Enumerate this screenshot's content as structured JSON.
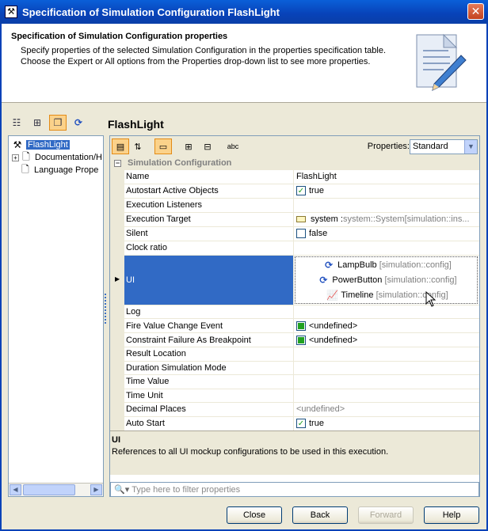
{
  "window": {
    "title": "Specification of Simulation Configuration FlashLight",
    "close_glyph": "✕"
  },
  "header": {
    "heading": "Specification of Simulation Configuration properties",
    "line1": "Specify properties of the selected Simulation Configuration in the properties specification table.",
    "line2": "Choose the Expert or All options from the Properties drop-down list to see more properties."
  },
  "panel": {
    "title": "FlashLight"
  },
  "tree": {
    "items": [
      {
        "label": "FlashLight",
        "icon": "tools-icon",
        "selected": true
      },
      {
        "label": "Documentation/H",
        "icon": "document-icon",
        "expander": "+"
      },
      {
        "label": "Language Prope",
        "icon": "document-icon"
      }
    ]
  },
  "properties": {
    "label": "Properties:",
    "selected": "Standard",
    "group": "Simulation Configuration",
    "rows": [
      {
        "name": "Name",
        "value": "FlashLight"
      },
      {
        "name": "Autostart Active Objects",
        "value": "true",
        "kind": "checked"
      },
      {
        "name": "Execution Listeners",
        "value": ""
      },
      {
        "name": "Execution Target",
        "value": "system : ",
        "value_b": "system::System",
        "value_c": " [simulation::ins..."
      },
      {
        "name": "Silent",
        "value": "false",
        "kind": "unchecked"
      },
      {
        "name": "Clock ratio",
        "value": ""
      },
      {
        "name": "UI",
        "kind": "ui",
        "items": [
          {
            "label": "LampBulb",
            "ref": "[simulation::config]",
            "icon": "refresh-icon"
          },
          {
            "label": "PowerButton",
            "ref": "[simulation::config]",
            "icon": "refresh-icon"
          },
          {
            "label": "Timeline",
            "ref": "[simulation::config]",
            "icon": "timeline-chart-icon"
          }
        ]
      },
      {
        "name": "Log",
        "value": ""
      },
      {
        "name": "Fire Value Change Event",
        "value": "<undefined>",
        "kind": "green"
      },
      {
        "name": "Constraint Failure As Breakpoint",
        "value": "<undefined>",
        "kind": "green"
      },
      {
        "name": "Result Location",
        "value": ""
      },
      {
        "name": "Duration Simulation Mode",
        "value": ""
      },
      {
        "name": "Time Value",
        "value": ""
      },
      {
        "name": "Time Unit",
        "value": ""
      },
      {
        "name": "Decimal Places",
        "value": "<undefined>",
        "kind": "gray"
      },
      {
        "name": "Auto Start",
        "value": "true",
        "kind": "checked"
      }
    ]
  },
  "description": {
    "title": "UI",
    "text": "References to all UI mockup configurations to be used in this execution."
  },
  "filter": {
    "placeholder": "Type here to filter properties"
  },
  "buttons": {
    "close": "Close",
    "back": "Back",
    "forward": "Forward",
    "help": "Help"
  },
  "toolbar": {
    "spell_label": "abc"
  }
}
